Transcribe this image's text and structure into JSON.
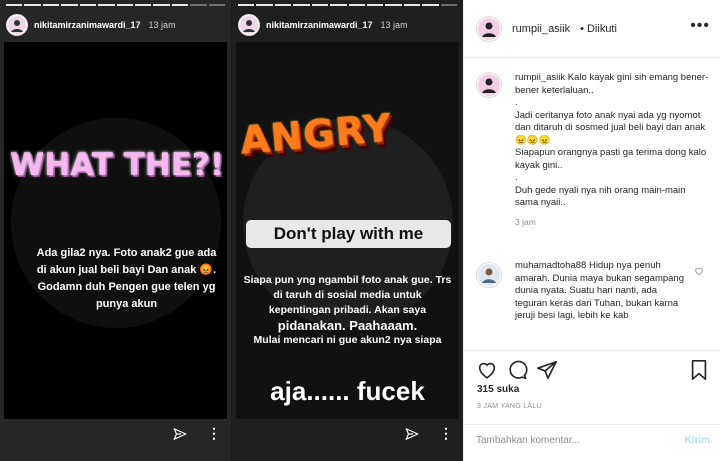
{
  "stories": [
    {
      "username": "nikitamirzanimawardi_17",
      "time": "13 jam",
      "big_text": "WHAT THE?!",
      "body_text": "Ada gila2 nya. Foto anak2 gue ada di akun jual beli bayi Dan anak 😡. Godamn duh Pengen gue telen yg punya akun"
    },
    {
      "username": "nikitamirzanimawardi_17",
      "time": "13 jam",
      "big_text": "ANGRY",
      "label_text": "Don't play with me",
      "body_text": "Siapa pun yng ngambil foto anak gue. Trs di taruh di sosial media untuk kepentingan pribadi. Akan saya",
      "body_text_2": "pidanakan. Paahaaam.",
      "body_text_3": "Mulai mencari ni gue akun2 nya siapa",
      "footer_big": "aja...... fucek"
    }
  ],
  "panel": {
    "username": "rumpii_asiik",
    "follow_status": "• Diikuti",
    "caption_user": "rumpii_asiik",
    "caption": " Kalo kayak gini sih emang bener-bener keterlaluan..\n.\nJadi ceritanya foto anak nyai ada yg nyomot dan ditaruh di sosmed jual beli bayi dan anak😠😠😠\nSiapapun orangnya pasti ga terima dong kalo kayak gini..\n.\nDuh gede nyali nya nih orang main-main sama nyaii..",
    "caption_time": "3 jam",
    "comment_user": "muhamadtoha88",
    "comment": " Hidup nya penuh amarah. Dunia maya bukan segampang dunia nyata. Suatu hari nanti, ada teguran keras dari Tuhan, bukan karna jeruji besi lagi, lebih ke kab",
    "likes": "315 suka",
    "posted": "3 JAM YANG LALU",
    "add_comment_placeholder": "Tambahkan komentar...",
    "post_label": "Kirim"
  },
  "colors": {
    "accent_light_blue": "#b2dffc",
    "what_pink": "#f7b7f0",
    "angry_orange": "#ff7a1a"
  },
  "icons": [
    "heart-icon",
    "comment-icon",
    "share-icon",
    "bookmark-icon",
    "send-icon",
    "more-icon"
  ]
}
